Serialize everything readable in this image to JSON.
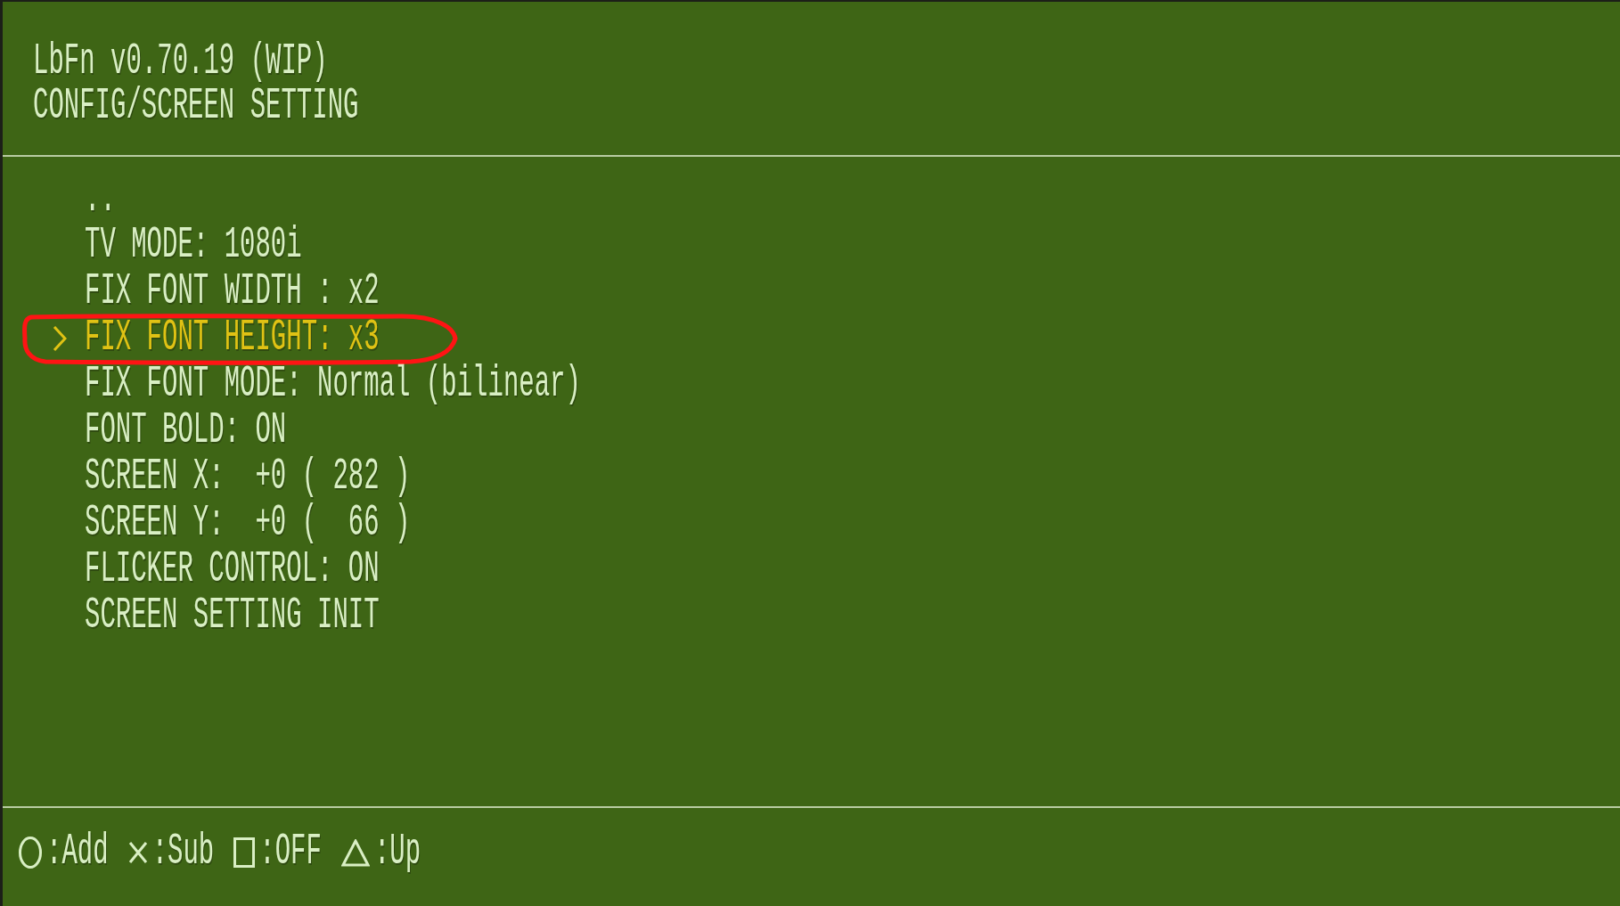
{
  "header": {
    "title": "LbFn v0.70.19 (WIP)",
    "subtitle": "CONFIG/SCREEN SETTING"
  },
  "menu": {
    "items": [
      {
        "label": "..",
        "selected": false
      },
      {
        "label": "TV MODE: 1080i",
        "selected": false
      },
      {
        "label": "FIX FONT WIDTH : x2",
        "selected": false
      },
      {
        "label": "FIX FONT HEIGHT: x3",
        "selected": true
      },
      {
        "label": "FIX FONT MODE: Normal (bilinear)",
        "selected": false
      },
      {
        "label": "FONT BOLD: ON",
        "selected": false
      },
      {
        "label": "SCREEN X:  +0 ( 282 )",
        "selected": false
      },
      {
        "label": "SCREEN Y:  +0 (  66 )",
        "selected": false
      },
      {
        "label": "FLICKER CONTROL: ON",
        "selected": false
      },
      {
        "label": "SCREEN SETTING INIT",
        "selected": false
      }
    ]
  },
  "annotation": {
    "kind": "loop"
  },
  "button_hints": [
    {
      "kind": "circle",
      "label": ":Add"
    },
    {
      "kind": "cross",
      "label": ":Sub"
    },
    {
      "kind": "square",
      "label": ":OFF"
    },
    {
      "kind": "triangle",
      "label": ":Up"
    }
  ]
}
